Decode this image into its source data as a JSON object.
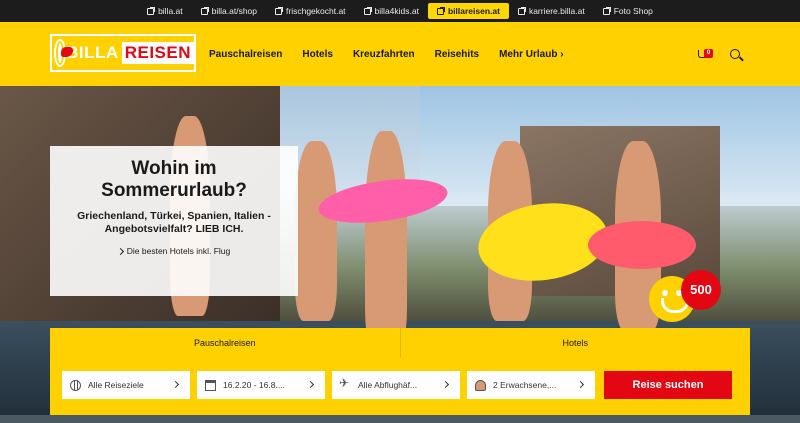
{
  "topbar": {
    "links": [
      {
        "label": "billa.at",
        "active": false
      },
      {
        "label": "billa.at/shop",
        "active": false
      },
      {
        "label": "frischgekocht.at",
        "active": false
      },
      {
        "label": "billa4kids.at",
        "active": false
      },
      {
        "label": "billareisen.at",
        "active": true
      },
      {
        "label": "karriere.billa.at",
        "active": false
      },
      {
        "label": "Foto Shop",
        "active": false
      }
    ]
  },
  "header": {
    "logo": {
      "part1": "BILLA",
      "part2": "REISEN"
    },
    "nav": [
      "Pauschalreisen",
      "Hotels",
      "Kreuzfahrten",
      "Reisehits",
      "Mehr Urlaub ›"
    ],
    "cart_count": "0",
    "colors": {
      "brand_yellow": "#ffd100",
      "brand_red": "#e30613"
    }
  },
  "hero": {
    "title": "Wohin im Sommerurlaub?",
    "text": "Griechenland, Türkei, Spanien, Italien - Angebotsvielfalt? LIEB ICH.",
    "link": "Die besten Hotels inkl. Flug",
    "badge": "500"
  },
  "search": {
    "tabs": [
      "Pauschalreisen",
      "Hotels"
    ],
    "destination": "Alle Reiseziele",
    "dates": "16.2.20 - 16.8....",
    "departure": "Alle Abflughäf...",
    "travellers": "2 Erwachsene,...",
    "submit": "Reise suchen"
  }
}
